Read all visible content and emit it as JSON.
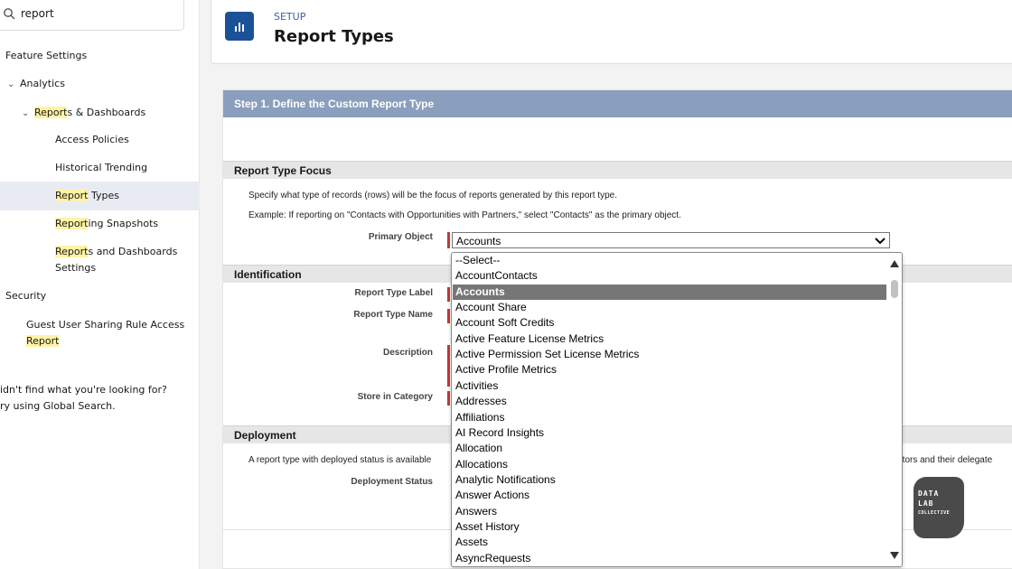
{
  "sidebar": {
    "search_value": "report",
    "feature_settings": "Feature Settings",
    "analytics": "Analytics",
    "reports_dashboards_hl": "Report",
    "reports_dashboards_rest": "s & Dashboards",
    "access_policies": "Access Policies",
    "historical_trending": "Historical Trending",
    "report_types_hl": "Report",
    "report_types_rest": " Types",
    "reporting_snapshots_hl": "Report",
    "reporting_snapshots_rest": "ing Snapshots",
    "reports_settings_hl": "Report",
    "reports_settings_rest": "s and Dashboards",
    "reports_settings_line2": "Settings",
    "security": "Security",
    "guest_rule_line1": "Guest User Sharing Rule Access",
    "guest_rule_hl": "Report",
    "not_found_line1": "idn't find what you're looking for?",
    "not_found_line2": "ry using Global Search."
  },
  "header": {
    "setup_label": "SETUP",
    "title": "Report Types"
  },
  "step": {
    "title": "Step 1. Define the Custom Report Type"
  },
  "report_type_focus": {
    "heading": "Report Type Focus",
    "desc1": "Specify what type of records (rows) will be the focus of reports generated by this report type.",
    "desc2": "Example: If reporting on \"Contacts with Opportunities with Partners,\" select \"Contacts\" as the primary object.",
    "primary_object_label": "Primary Object",
    "primary_object_value": "Accounts"
  },
  "identification": {
    "heading": "Identification",
    "label_label": "Report Type Label",
    "name_label": "Report Type Name",
    "description_label": "Description",
    "category_label": "Store in Category"
  },
  "deployment": {
    "heading": "Deployment",
    "desc_left": "A report type with deployed status is available",
    "desc_right": "trators and their delegate",
    "status_label": "Deployment Status"
  },
  "dropdown": {
    "options": [
      "--Select--",
      "AccountContacts",
      "Accounts",
      "Account Share",
      "Account Soft Credits",
      "Active Feature License Metrics",
      "Active Permission Set License Metrics",
      "Active Profile Metrics",
      "Activities",
      "Addresses",
      "Affiliations",
      "AI Record Insights",
      "Allocation",
      "Allocations",
      "Analytic Notifications",
      "Answer Actions",
      "Answers",
      "Asset History",
      "Assets",
      "AsyncRequests"
    ],
    "selected": "Accounts"
  },
  "watermark": {
    "line1": "DATA",
    "line2": "LAB",
    "line3": "COLLECTIVE"
  },
  "colors": {
    "step_bar": "#8a9ebe",
    "required": "#c23934",
    "highlight": "#fff3a6",
    "header_icon": "#1b5297",
    "selected_option": "#767676"
  }
}
